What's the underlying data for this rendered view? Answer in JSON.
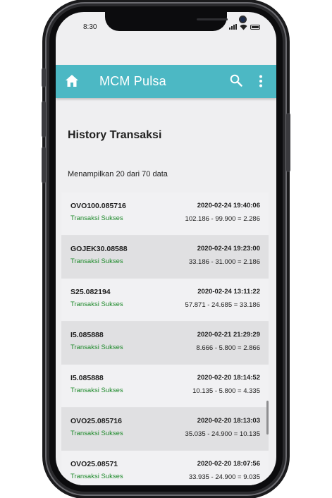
{
  "status_bar": {
    "time": "8:30"
  },
  "app_bar": {
    "title": "MCM Pulsa",
    "icons": [
      "home-icon",
      "search-icon",
      "more-vert-icon"
    ],
    "color": "#4cb8c4"
  },
  "page": {
    "title": "History Transaksi",
    "summary": "Menampilkan 20 dari 70 data"
  },
  "transactions": [
    {
      "code": "OVO100.085716",
      "status": "Transaksi Sukses",
      "datetime": "2020-02-24 19:40:06",
      "calc": "102.186 - 99.900 = 2.286"
    },
    {
      "code": "GOJEK30.08588",
      "status": "Transaksi Sukses",
      "datetime": "2020-02-24 19:23:00",
      "calc": "33.186 - 31.000 = 2.186"
    },
    {
      "code": "S25.082194",
      "status": "Transaksi Sukses",
      "datetime": "2020-02-24 13:11:22",
      "calc": "57.871 - 24.685 = 33.186"
    },
    {
      "code": "I5.085888",
      "status": "Transaksi Sukses",
      "datetime": "2020-02-21 21:29:29",
      "calc": "8.666 - 5.800 = 2.866"
    },
    {
      "code": "I5.085888",
      "status": "Transaksi Sukses",
      "datetime": "2020-02-20 18:14:52",
      "calc": "10.135 - 5.800 = 4.335"
    },
    {
      "code": "OVO25.085716",
      "status": "Transaksi Sukses",
      "datetime": "2020-02-20 18:13:03",
      "calc": "35.035 - 24.900 = 10.135"
    },
    {
      "code": "OVO25.08571",
      "status": "Transaksi Sukses",
      "datetime": "2020-02-20 18:07:56",
      "calc": "33.935 - 24.900 = 9.035"
    }
  ],
  "colors": {
    "success": "#1e8a2b",
    "row_alt": "#e0e0e2"
  }
}
